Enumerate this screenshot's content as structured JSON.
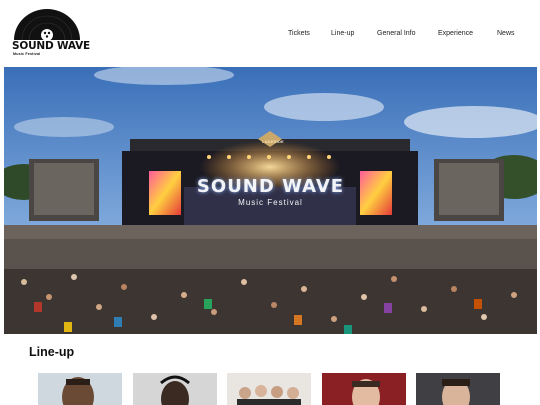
{
  "brand": {
    "name": "SOUND WAVE",
    "tagline": "Music Festival"
  },
  "nav": {
    "items": [
      {
        "label": "Tickets",
        "icon": null
      },
      {
        "label": "Line-up",
        "icon": null
      },
      {
        "label": "General Info",
        "icon": null
      },
      {
        "label": "Experience",
        "icon": null
      },
      {
        "label": "News",
        "icon": null
      }
    ]
  },
  "hero": {
    "image": "festival-crowd-stage-photo",
    "screen_title": "SOUND WAVE",
    "screen_subtitle": "Music Festival",
    "stage_sign": "LAKESIDE"
  },
  "lineup": {
    "heading": "Line-up",
    "artists": [
      {
        "photo": "artist-photo-1"
      },
      {
        "photo": "artist-photo-2"
      },
      {
        "photo": "artist-photo-3"
      },
      {
        "photo": "artist-photo-4"
      },
      {
        "photo": "artist-photo-5"
      }
    ]
  },
  "colors": {
    "sky": "#4f86c6",
    "stage_light": "#ffb547",
    "background": "#ffffff",
    "text": "#111111"
  }
}
